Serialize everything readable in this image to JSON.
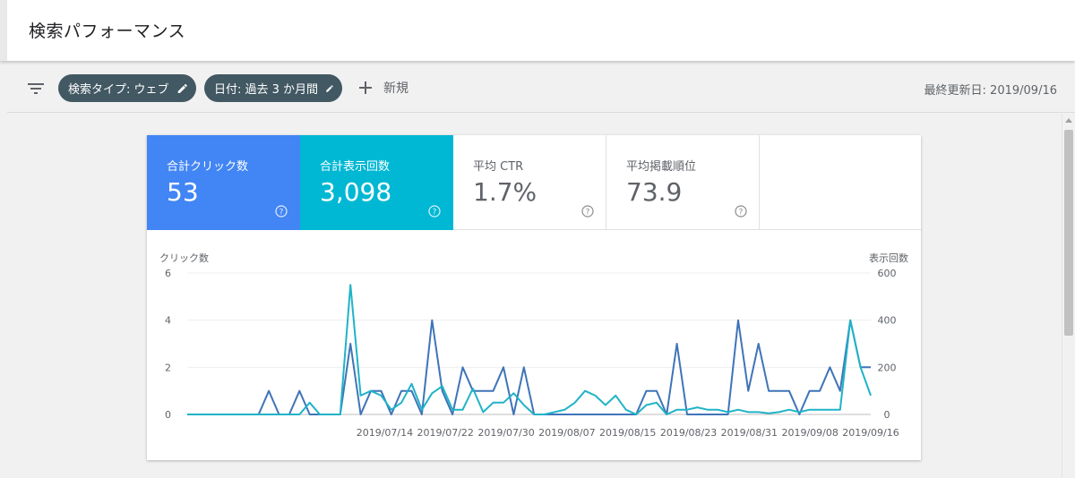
{
  "header": {
    "title": "検索パフォーマンス"
  },
  "toolbar": {
    "filter_chips": [
      {
        "label": "検索タイプ: ウェブ"
      },
      {
        "label": "日付: 過去 3 か月間"
      }
    ],
    "new_label": "新規",
    "last_updated": "最終更新日: 2019/09/16"
  },
  "metrics": [
    {
      "label": "合計クリック数",
      "value": "53",
      "selected": true,
      "color": "#4285f4"
    },
    {
      "label": "合計表示回数",
      "value": "3,098",
      "selected": true,
      "color": "#00b8d4"
    },
    {
      "label": "平均 CTR",
      "value": "1.7%",
      "selected": false
    },
    {
      "label": "平均掲載順位",
      "value": "73.9",
      "selected": false
    }
  ],
  "chart_data": {
    "type": "line",
    "left_axis_label": "クリック数",
    "right_axis_label": "表示回数",
    "left_ylim": [
      0,
      6
    ],
    "right_ylim": [
      0,
      600
    ],
    "left_ticks": [
      "0",
      "2",
      "4",
      "6"
    ],
    "right_ticks": [
      "0",
      "200",
      "400",
      "600"
    ],
    "x_tick_labels": [
      "2019/07/14",
      "2019/07/22",
      "2019/07/30",
      "2019/08/07",
      "2019/08/15",
      "2019/08/23",
      "2019/08/31",
      "2019/09/08",
      "2019/09/16"
    ],
    "x_start": "2019/06/18",
    "x_end": "2019/09/16",
    "grid": true,
    "series": [
      {
        "name": "合計クリック数",
        "axis": "left",
        "color": "#3f74b8",
        "values": [
          0,
          0,
          0,
          0,
          0,
          0,
          0,
          0,
          1,
          0,
          0,
          1,
          0,
          0,
          0,
          0,
          3,
          0,
          1,
          1,
          0,
          1,
          1,
          0,
          4,
          1,
          0,
          2,
          1,
          1,
          1,
          2,
          0,
          2,
          0,
          0,
          0,
          0,
          0,
          0,
          0,
          0,
          0,
          0,
          0,
          1,
          1,
          0,
          3,
          0,
          0,
          0,
          0,
          0,
          4,
          1,
          3,
          1,
          1,
          1,
          0,
          1,
          1,
          2,
          1,
          4,
          2,
          2
        ]
      },
      {
        "name": "合計表示回数",
        "axis": "right",
        "color": "#20b3c7",
        "values": [
          0,
          0,
          0,
          0,
          0,
          0,
          0,
          0,
          0,
          0,
          0,
          0,
          50,
          0,
          0,
          0,
          550,
          80,
          100,
          80,
          20,
          50,
          130,
          20,
          90,
          120,
          20,
          20,
          110,
          10,
          50,
          50,
          90,
          40,
          0,
          0,
          10,
          20,
          50,
          100,
          80,
          40,
          80,
          20,
          0,
          40,
          50,
          0,
          20,
          20,
          30,
          20,
          20,
          10,
          20,
          10,
          10,
          5,
          10,
          20,
          10,
          20,
          20,
          20,
          20,
          400,
          200,
          80
        ]
      }
    ]
  }
}
